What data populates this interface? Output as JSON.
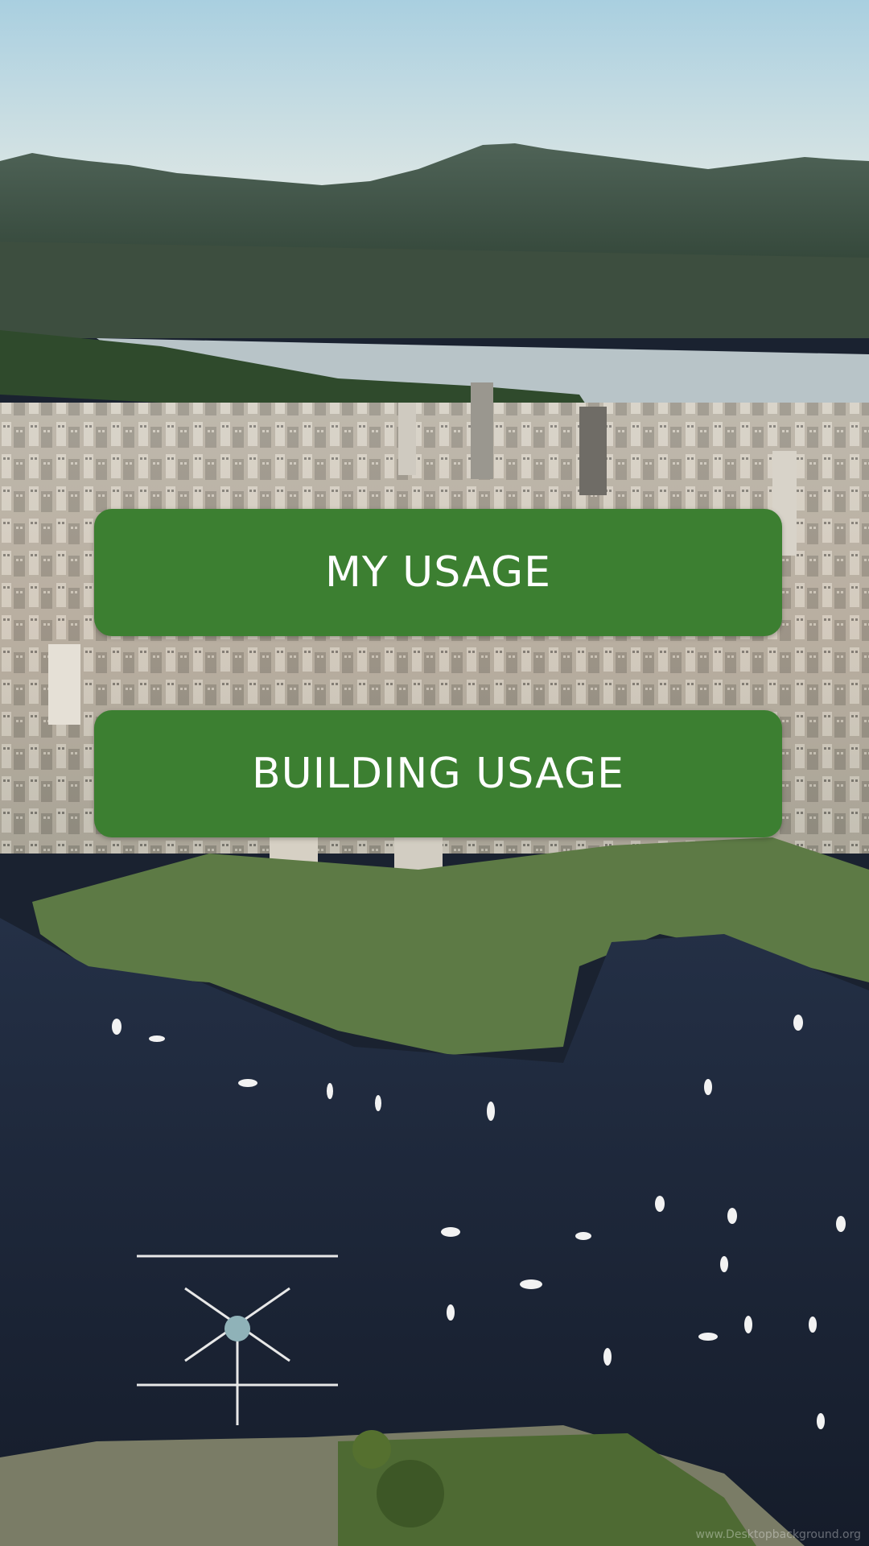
{
  "background": {
    "description_icon": "city-aerial-photo",
    "watermark": "www.Desktopbackground.org"
  },
  "buttons": {
    "my_usage_label": "MY USAGE",
    "building_usage_label": "BUILDING USAGE"
  },
  "colors": {
    "button_green": "#3c7f31",
    "sky_top": "#a9cfe0",
    "water": "#1d2638"
  }
}
